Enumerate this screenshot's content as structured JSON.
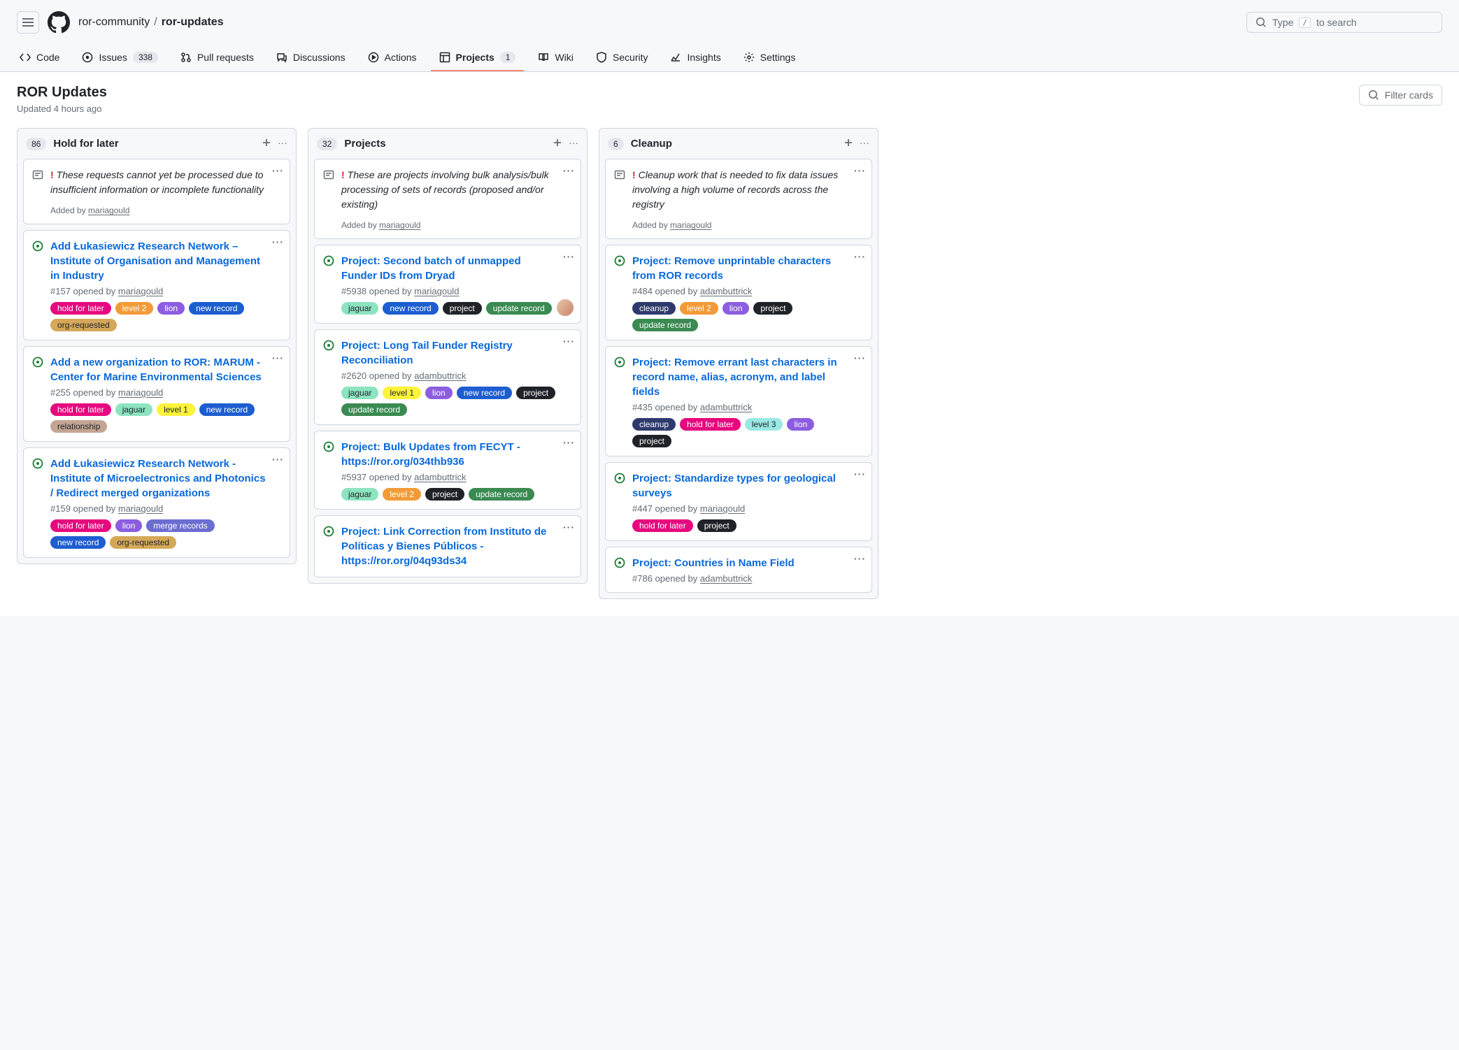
{
  "header": {
    "breadcrumb_org": "ror-community",
    "breadcrumb_repo": "ror-updates",
    "search_placeholder": "Type",
    "search_suffix": "to search",
    "search_kbd": "/"
  },
  "repoTabs": {
    "code": "Code",
    "issues": "Issues",
    "issues_count": "338",
    "pull_requests": "Pull requests",
    "discussions": "Discussions",
    "actions": "Actions",
    "projects": "Projects",
    "projects_count": "1",
    "wiki": "Wiki",
    "security": "Security",
    "insights": "Insights",
    "settings": "Settings"
  },
  "project": {
    "title": "ROR Updates",
    "updated": "Updated 4 hours ago",
    "filter_placeholder": "Filter cards"
  },
  "columns": [
    {
      "count": "86",
      "title": "Hold for later",
      "note": {
        "text": "These requests cannot yet be processed due to insufficient information or incomplete functionality",
        "added_by_prefix": "Added by ",
        "added_by_user": "mariagould"
      },
      "cards": [
        {
          "title": "Add Łukasiewicz Research Network – Institute of Organisation and Management in Industry",
          "meta_prefix": "#157 opened by ",
          "author": "mariagould",
          "labels": [
            "hold for later",
            "level 2",
            "lion",
            "new record",
            "org-requested"
          ]
        },
        {
          "title": "Add a new organization to ROR: MARUM - Center for Marine Environmental Sciences",
          "meta_prefix": "#255 opened by ",
          "author": "mariagould",
          "labels": [
            "hold for later",
            "jaguar",
            "level 1",
            "new record",
            "relationship"
          ]
        },
        {
          "title": "Add Łukasiewicz Research Network - Institute of Microelectronics and Photonics / Redirect merged organizations",
          "meta_prefix": "#159 opened by ",
          "author": "mariagould",
          "labels": [
            "hold for later",
            "lion",
            "merge records",
            "new record",
            "org-requested"
          ]
        }
      ]
    },
    {
      "count": "32",
      "title": "Projects",
      "note": {
        "text": "These are projects involving bulk analysis/bulk processing of sets of records (proposed and/or existing)",
        "added_by_prefix": "Added by ",
        "added_by_user": "mariagould"
      },
      "cards": [
        {
          "title": "Project: Second batch of unmapped Funder IDs from Dryad",
          "meta_prefix": "#5938 opened by ",
          "author": "mariagould",
          "labels": [
            "jaguar",
            "new record",
            "project",
            "update record"
          ],
          "avatar": true
        },
        {
          "title": "Project: Long Tail Funder Registry Reconciliation",
          "meta_prefix": "#2620 opened by ",
          "author": "adambuttrick",
          "labels": [
            "jaguar",
            "level 1",
            "lion",
            "new record",
            "project",
            "update record"
          ]
        },
        {
          "title": "Project: Bulk Updates from FECYT - https://ror.org/034thb936",
          "meta_prefix": "#5937 opened by ",
          "author": "adambuttrick",
          "labels": [
            "jaguar",
            "level 2",
            "project",
            "update record"
          ]
        },
        {
          "title": "Project: Link Correction from Instituto de Políticas y Bienes Públicos - https://ror.org/04q93ds34",
          "meta_prefix": "",
          "author": "",
          "labels": []
        }
      ]
    },
    {
      "count": "6",
      "title": "Cleanup",
      "note": {
        "text": "Cleanup work that is needed to fix data issues involving a high volume of records across the registry",
        "added_by_prefix": "Added by ",
        "added_by_user": "mariagould"
      },
      "cards": [
        {
          "title": "Project: Remove unprintable characters from ROR records",
          "meta_prefix": "#484 opened by ",
          "author": "adambuttrick",
          "labels": [
            "cleanup",
            "level 2",
            "lion",
            "project",
            "update record"
          ]
        },
        {
          "title": "Project: Remove errant last characters in record name, alias, acronym, and label fields",
          "meta_prefix": "#435 opened by ",
          "author": "adambuttrick",
          "labels": [
            "cleanup",
            "hold for later",
            "level 3",
            "lion",
            "project"
          ]
        },
        {
          "title": "Project: Standardize types for geological surveys",
          "meta_prefix": "#447 opened by ",
          "author": "mariagould",
          "labels": [
            "hold for later",
            "project"
          ]
        },
        {
          "title": "Project: Countries in Name Field",
          "meta_prefix": "#786 opened by ",
          "author": "adambuttrick",
          "labels": []
        }
      ]
    }
  ],
  "labelClassMap": {
    "hold for later": "lbl-hold-for-later",
    "level 1": "lbl-level-1",
    "level 2": "lbl-level-2",
    "level 3": "lbl-level-3",
    "lion": "lbl-lion",
    "new record": "lbl-new-record",
    "org-requested": "lbl-org-requested",
    "jaguar": "lbl-jaguar",
    "project": "lbl-project",
    "update record": "lbl-update-record",
    "relationship": "lbl-relationship",
    "merge records": "lbl-merge-records",
    "cleanup": "lbl-cleanup"
  }
}
